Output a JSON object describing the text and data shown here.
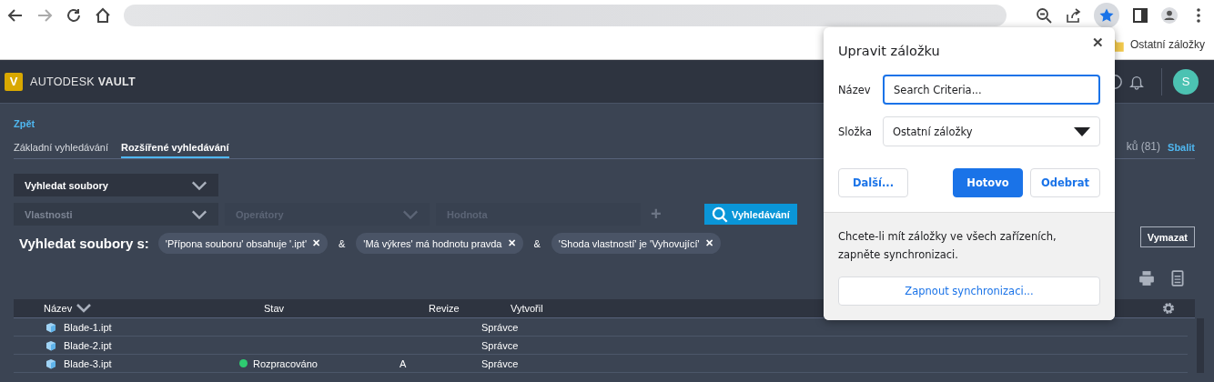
{
  "browser": {
    "bookmark_bar": {
      "folder": "Ostatní záložky"
    }
  },
  "app": {
    "brand": {
      "logo_letter": "V",
      "name": "AUTODESK",
      "product": "VAULT"
    },
    "user_initial": "S"
  },
  "back_link": "Zpět",
  "tabs": [
    {
      "label": "Základní vyhledávání",
      "selected": false
    },
    {
      "label": "Rozšířené vyhledávání",
      "selected": true
    }
  ],
  "results_summary": {
    "count_text": "ků (81)",
    "collapse_link": "Sbalit"
  },
  "search_type": "Vyhledat soubory",
  "criteria_inputs": [
    {
      "placeholder": "Vlastnosti",
      "disabled": false
    },
    {
      "placeholder": "Operátory",
      "disabled": true
    },
    {
      "placeholder": "Hodnota",
      "disabled": true
    }
  ],
  "add_symbol": "+",
  "search_button": "Vyhledávání",
  "criteria_label": "Vyhledat soubory s:",
  "criteria": [
    {
      "text": "'Přípona souboru' obsahuje '.ipt'",
      "remove": "✕"
    },
    {
      "text": "'Má výkres' má hodnotu pravda",
      "remove": "✕"
    },
    {
      "text": "'Shoda vlastností' je 'Vyhovující'",
      "remove": "✕"
    }
  ],
  "joiner": "&",
  "clear_button": "Vymazat",
  "table": {
    "columns": [
      {
        "label": "Název",
        "sorted": true
      },
      {
        "label": "Stav",
        "sorted": false
      },
      {
        "label": "Revize",
        "sorted": false
      },
      {
        "label": "Vytvořil",
        "sorted": false
      }
    ],
    "rows": [
      {
        "name": "Blade-1.ipt",
        "state": "",
        "revision": "",
        "created_by": "Správce"
      },
      {
        "name": "Blade-2.ipt",
        "state": "",
        "revision": "",
        "created_by": "Správce"
      },
      {
        "name": "Blade-3.ipt",
        "state": "Rozpracováno",
        "color": "#2ecc71",
        "revision": "A",
        "created_by": "Správce"
      }
    ]
  },
  "bookmark_dialog": {
    "title": "Upravit záložku",
    "close": "✕",
    "name_label": "Název",
    "name_value": "Search Criteria...",
    "folder_label": "Složka",
    "folder_value": "Ostatní záložky",
    "buttons": [
      {
        "label": "Další...",
        "kind": "secondary"
      },
      {
        "label": "Hotovo",
        "kind": "primary"
      },
      {
        "label": "Odebrat",
        "kind": "secondary"
      }
    ],
    "sync_text": "Chcete-li mít záložky ve všech zařízeních, zapněte synchronizaci.",
    "sync_button": "Zapnout synchronizaci..."
  }
}
